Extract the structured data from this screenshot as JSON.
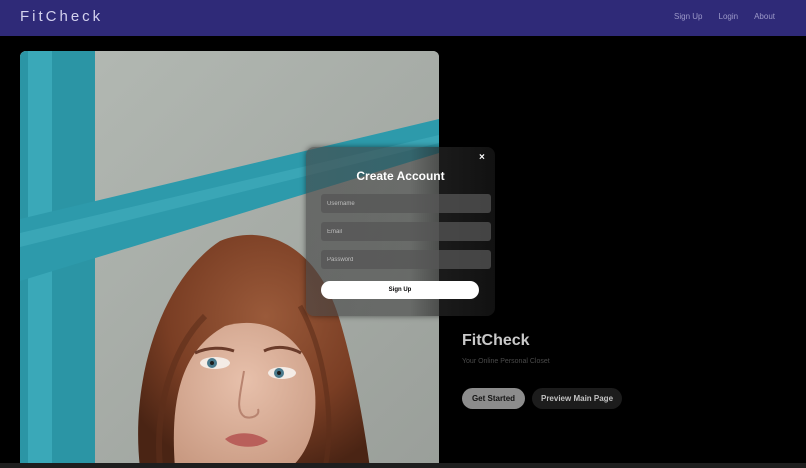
{
  "navbar": {
    "logo": "FitCheck",
    "links": [
      "Sign Up",
      "Login",
      "About"
    ]
  },
  "hero": {
    "title": "FitCheck",
    "subtitle": "Your Online Personal Closet",
    "primary_button": "Get Started",
    "secondary_button": "Preview Main Page"
  },
  "modal": {
    "close_icon": "×",
    "title": "Create Account",
    "username_placeholder": "Username",
    "email_placeholder": "Email",
    "password_placeholder": "Password",
    "submit_label": "Sign Up"
  },
  "colors": {
    "navbar": "#2f2a78",
    "background": "#000000",
    "modal_button": "#ffffff"
  }
}
